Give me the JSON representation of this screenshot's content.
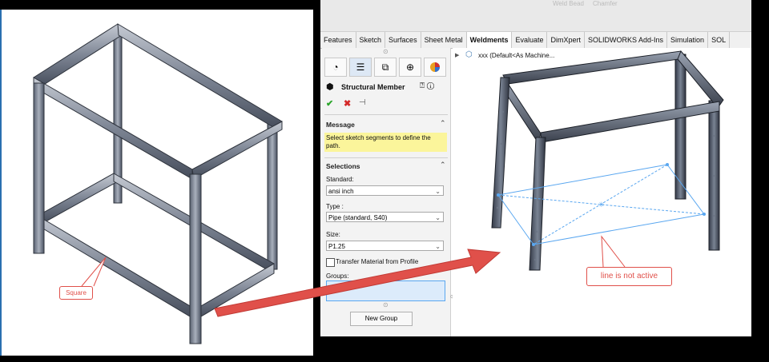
{
  "left_image": {
    "callout": "Square"
  },
  "toolbar_ghost": {
    "weld_bead": "Weld Bead",
    "chamfer": "Chamfer"
  },
  "tabs": [
    "Features",
    "Sketch",
    "Surfaces",
    "Sheet Metal",
    "Weldments",
    "Evaluate",
    "DimXpert",
    "SOLIDWORKS Add-Ins",
    "Simulation",
    "SOL"
  ],
  "active_tab": "Weldments",
  "tree": {
    "root": "xxx  (Default<As Machine..."
  },
  "property_manager": {
    "title": "Structural Member",
    "message_header": "Message",
    "message_text": "Select sketch segments to define the path.",
    "selections_header": "Selections",
    "standard_label": "Standard:",
    "standard_value": "ansi inch",
    "type_label": "Type :",
    "type_value": "Pipe (standard, S40)",
    "size_label": "Size:",
    "size_value": "P1.25",
    "transfer_label": "Transfer Material from Profile",
    "groups_label": "Groups:",
    "new_group_button": "New Group"
  },
  "viewport": {
    "callout": "line is not active"
  },
  "colors": {
    "accent_yellow": "#fbf59b",
    "selection_blue": "#5aa7f0",
    "arrow_red": "#e0504a",
    "ok_green": "#2aa52a",
    "cancel_red": "#d42a2a"
  },
  "icons": [
    "feature-manager-icon",
    "property-manager-icon",
    "configuration-manager-icon",
    "dimxpert-icon",
    "appearance-icon",
    "structural-member-icon",
    "help-icon",
    "ok-check-icon",
    "cancel-x-icon",
    "pin-icon",
    "part-icon"
  ]
}
